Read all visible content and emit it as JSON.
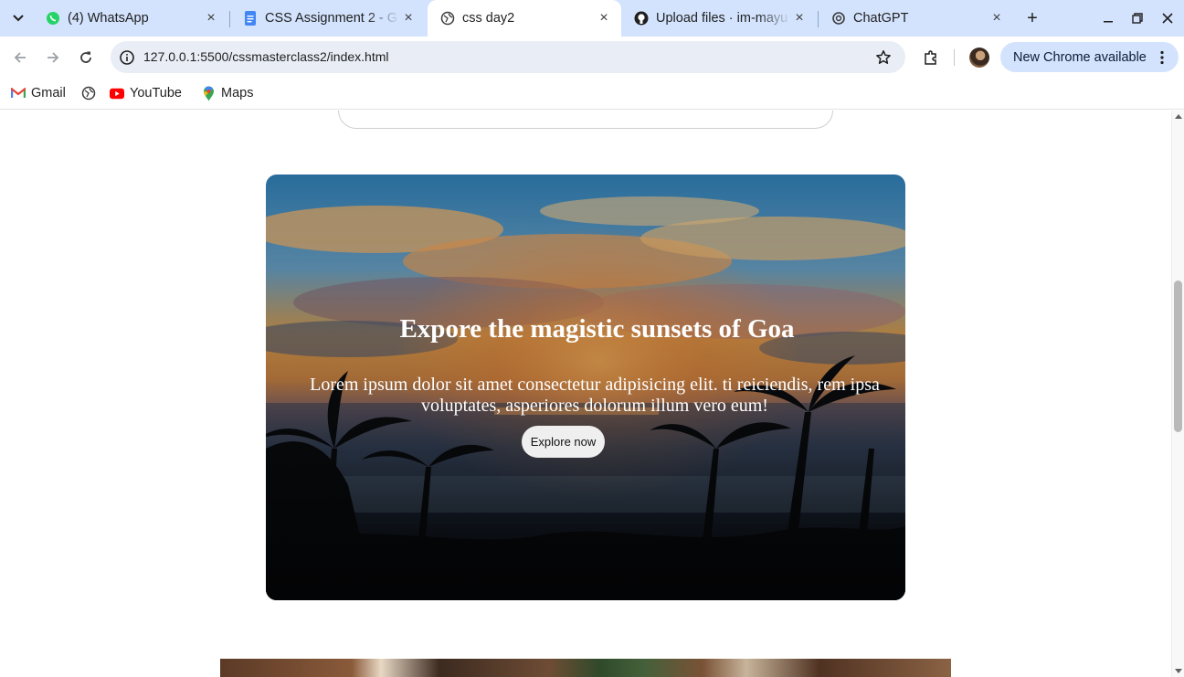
{
  "browser": {
    "tabs": [
      {
        "title": "(4) WhatsApp",
        "icon": "whatsapp-icon",
        "close": "×"
      },
      {
        "title": "CSS Assignment 2 - G",
        "icon": "google-docs-icon",
        "close": "×"
      },
      {
        "title": "css day2",
        "icon": "globe-icon",
        "close": "×",
        "active": true
      },
      {
        "title": "Upload files · im-mayu",
        "icon": "github-icon",
        "close": "×"
      },
      {
        "title": "ChatGPT",
        "icon": "chatgpt-icon",
        "close": "×"
      }
    ],
    "new_tab_label": "+",
    "url": "127.0.0.1:5500/cssmasterclass2/index.html",
    "update_button": "New Chrome available",
    "bookmarks": [
      {
        "label": "Gmail",
        "icon": "gmail-icon"
      },
      {
        "label": "",
        "icon": "globe-icon"
      },
      {
        "label": "YouTube",
        "icon": "youtube-icon"
      },
      {
        "label": "Maps",
        "icon": "maps-icon"
      }
    ]
  },
  "page": {
    "hero": {
      "title": "Expore the magistic sunsets of Goa",
      "text": "Lorem ipsum dolor sit amet consectetur adipisicing elit. ti reiciendis, rem ipsa voluptates, asperiores dolorum illum vero eum!",
      "button": "Explore now"
    }
  },
  "colors": {
    "tabstrip": "#d3e3fd",
    "omnibox": "#e9eef6",
    "update_button": "#d3e3fd"
  }
}
